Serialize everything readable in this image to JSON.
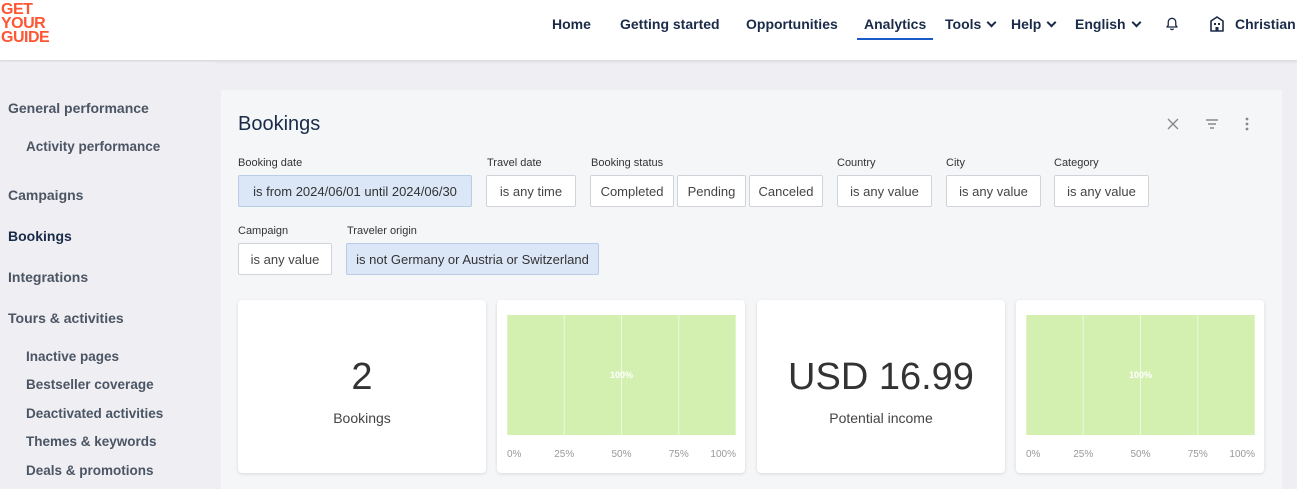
{
  "logo": {
    "line1": "GET",
    "line2": "YOUR",
    "line3": "GUIDE",
    "color": "#ff5533"
  },
  "nav": {
    "items": [
      {
        "label": "Home"
      },
      {
        "label": "Getting started"
      },
      {
        "label": "Opportunities"
      },
      {
        "label": "Analytics"
      },
      {
        "label": "Tools"
      },
      {
        "label": "Help"
      },
      {
        "label": "English"
      }
    ],
    "active": "Analytics",
    "user": "Christian",
    "accent": "#1a5ac9"
  },
  "sidebar": {
    "items": [
      {
        "label": "General performance"
      },
      {
        "label": "Activity performance"
      },
      {
        "label": "Campaigns"
      },
      {
        "label": "Bookings"
      },
      {
        "label": "Integrations"
      },
      {
        "label": "Tours & activities"
      },
      {
        "label": "Inactive pages"
      },
      {
        "label": "Bestseller coverage"
      },
      {
        "label": "Deactivated activities"
      },
      {
        "label": "Themes & keywords"
      },
      {
        "label": "Deals & promotions"
      }
    ],
    "current": "Bookings"
  },
  "panel": {
    "title": "Bookings",
    "filters": {
      "booking_date": {
        "label": "Booking date",
        "value": "is from 2024/06/01 until 2024/06/30"
      },
      "travel_date": {
        "label": "Travel date",
        "value": "is any time"
      },
      "booking_status": {
        "label": "Booking status",
        "options": [
          "Completed",
          "Pending",
          "Canceled"
        ]
      },
      "country": {
        "label": "Country",
        "value": "is any value"
      },
      "city": {
        "label": "City",
        "value": "is any value"
      },
      "category": {
        "label": "Category",
        "value": "is any value"
      },
      "campaign": {
        "label": "Campaign",
        "value": "is any value"
      },
      "traveler_origin": {
        "label": "Traveler origin",
        "value": "is not Germany or Austria or Switzerland"
      }
    },
    "highlight_color": "#dbe7f7"
  },
  "kpis": [
    {
      "value": "2",
      "label": "Bookings"
    },
    {
      "value": "USD 16.99",
      "label": "Potential income"
    }
  ],
  "chart_data": [
    {
      "type": "bar",
      "orientation": "horizontal",
      "values": [
        100
      ],
      "data_labels": [
        "100%"
      ],
      "xticks": [
        "0%",
        "25%",
        "50%",
        "75%",
        "100%"
      ],
      "xlim": [
        0,
        100
      ],
      "color": "#d3f0b1"
    },
    {
      "type": "bar",
      "orientation": "horizontal",
      "values": [
        100
      ],
      "data_labels": [
        "100%"
      ],
      "xticks": [
        "0%",
        "25%",
        "50%",
        "75%",
        "100%"
      ],
      "xlim": [
        0,
        100
      ],
      "color": "#d3f0b1"
    }
  ]
}
